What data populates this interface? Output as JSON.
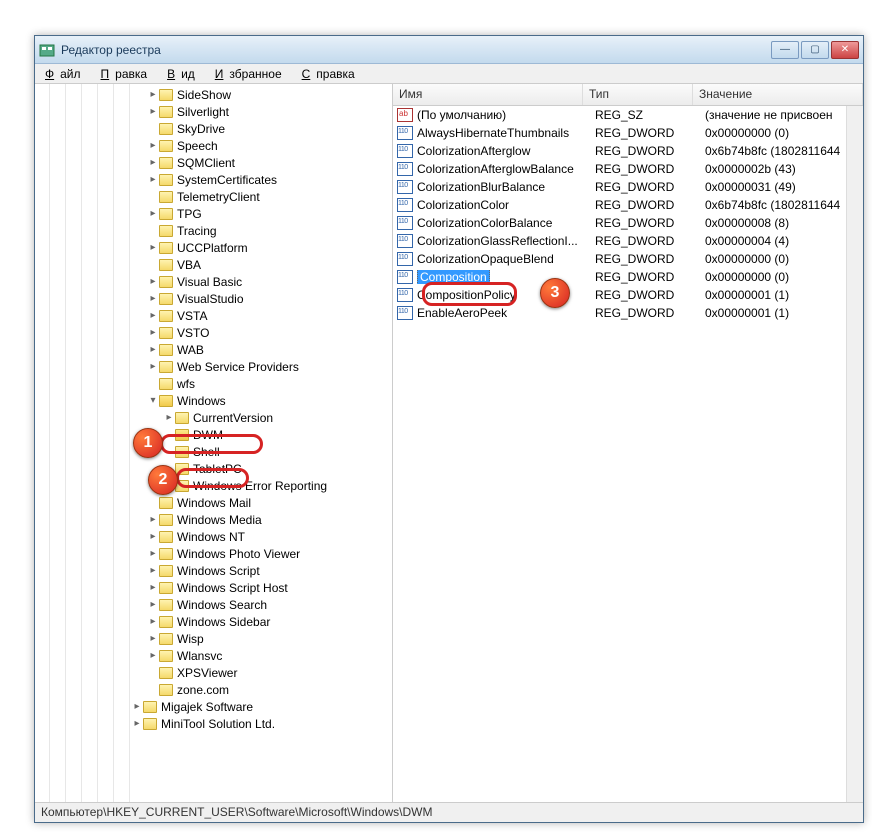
{
  "window": {
    "title": "Редактор реестра",
    "buttons": {
      "min": "—",
      "max": "▢",
      "close": "✕"
    }
  },
  "menu": {
    "file": "Файл",
    "edit": "Правка",
    "view": "Вид",
    "favorites": "Избранное",
    "help": "Справка"
  },
  "statusbar": "Компьютер\\HKEY_CURRENT_USER\\Software\\Microsoft\\Windows\\DWM",
  "columns": {
    "name": "Имя",
    "type": "Тип",
    "value": "Значение"
  },
  "tree": [
    {
      "indent": 7,
      "exp": "closed",
      "label": "SideShow"
    },
    {
      "indent": 7,
      "exp": "closed",
      "label": "Silverlight"
    },
    {
      "indent": 7,
      "exp": "none",
      "label": "SkyDrive"
    },
    {
      "indent": 7,
      "exp": "closed",
      "label": "Speech"
    },
    {
      "indent": 7,
      "exp": "closed",
      "label": "SQMClient"
    },
    {
      "indent": 7,
      "exp": "closed",
      "label": "SystemCertificates"
    },
    {
      "indent": 7,
      "exp": "none",
      "label": "TelemetryClient"
    },
    {
      "indent": 7,
      "exp": "closed",
      "label": "TPG"
    },
    {
      "indent": 7,
      "exp": "none",
      "label": "Tracing"
    },
    {
      "indent": 7,
      "exp": "closed",
      "label": "UCCPlatform"
    },
    {
      "indent": 7,
      "exp": "none",
      "label": "VBA"
    },
    {
      "indent": 7,
      "exp": "closed",
      "label": "Visual Basic"
    },
    {
      "indent": 7,
      "exp": "closed",
      "label": "VisualStudio"
    },
    {
      "indent": 7,
      "exp": "closed",
      "label": "VSTA"
    },
    {
      "indent": 7,
      "exp": "closed",
      "label": "VSTO"
    },
    {
      "indent": 7,
      "exp": "closed",
      "label": "WAB"
    },
    {
      "indent": 7,
      "exp": "closed",
      "label": "Web Service Providers"
    },
    {
      "indent": 7,
      "exp": "none",
      "label": "wfs"
    },
    {
      "indent": 7,
      "exp": "open",
      "label": "Windows",
      "open": true,
      "annot": 1
    },
    {
      "indent": 8,
      "exp": "closed",
      "label": "CurrentVersion"
    },
    {
      "indent": 8,
      "exp": "none",
      "label": "DWM",
      "open": true,
      "annot": 2
    },
    {
      "indent": 8,
      "exp": "none",
      "label": "Shell"
    },
    {
      "indent": 8,
      "exp": "none",
      "label": "TabletPC"
    },
    {
      "indent": 8,
      "exp": "closed",
      "label": "Windows Error Reporting"
    },
    {
      "indent": 7,
      "exp": "none",
      "label": "Windows Mail"
    },
    {
      "indent": 7,
      "exp": "closed",
      "label": "Windows Media"
    },
    {
      "indent": 7,
      "exp": "closed",
      "label": "Windows NT"
    },
    {
      "indent": 7,
      "exp": "closed",
      "label": "Windows Photo Viewer"
    },
    {
      "indent": 7,
      "exp": "closed",
      "label": "Windows Script"
    },
    {
      "indent": 7,
      "exp": "closed",
      "label": "Windows Script Host"
    },
    {
      "indent": 7,
      "exp": "closed",
      "label": "Windows Search"
    },
    {
      "indent": 7,
      "exp": "closed",
      "label": "Windows Sidebar"
    },
    {
      "indent": 7,
      "exp": "closed",
      "label": "Wisp"
    },
    {
      "indent": 7,
      "exp": "closed",
      "label": "Wlansvc"
    },
    {
      "indent": 7,
      "exp": "none",
      "label": "XPSViewer"
    },
    {
      "indent": 7,
      "exp": "none",
      "label": "zone.com"
    },
    {
      "indent": 6,
      "exp": "closed",
      "label": "Migajek Software"
    },
    {
      "indent": 6,
      "exp": "closed",
      "label": "MiniTool Solution Ltd."
    }
  ],
  "values": [
    {
      "icon": "str",
      "name": "(По умолчанию)",
      "type": "REG_SZ",
      "value": "(значение не присвоен"
    },
    {
      "icon": "bin",
      "name": "AlwaysHibernateThumbnails",
      "type": "REG_DWORD",
      "value": "0x00000000 (0)"
    },
    {
      "icon": "bin",
      "name": "ColorizationAfterglow",
      "type": "REG_DWORD",
      "value": "0x6b74b8fc (1802811644"
    },
    {
      "icon": "bin",
      "name": "ColorizationAfterglowBalance",
      "type": "REG_DWORD",
      "value": "0x0000002b (43)"
    },
    {
      "icon": "bin",
      "name": "ColorizationBlurBalance",
      "type": "REG_DWORD",
      "value": "0x00000031 (49)"
    },
    {
      "icon": "bin",
      "name": "ColorizationColor",
      "type": "REG_DWORD",
      "value": "0x6b74b8fc (1802811644"
    },
    {
      "icon": "bin",
      "name": "ColorizationColorBalance",
      "type": "REG_DWORD",
      "value": "0x00000008 (8)"
    },
    {
      "icon": "bin",
      "name": "ColorizationGlassReflectionI...",
      "type": "REG_DWORD",
      "value": "0x00000004 (4)"
    },
    {
      "icon": "bin",
      "name": "ColorizationOpaqueBlend",
      "type": "REG_DWORD",
      "value": "0x00000000 (0)"
    },
    {
      "icon": "bin",
      "name": "Composition",
      "type": "REG_DWORD",
      "value": "0x00000000 (0)",
      "selected": true,
      "annot": 3
    },
    {
      "icon": "bin",
      "name": "CompositionPolicy",
      "type": "REG_DWORD",
      "value": "0x00000001 (1)"
    },
    {
      "icon": "bin",
      "name": "EnableAeroPeek",
      "type": "REG_DWORD",
      "value": "0x00000001 (1)"
    }
  ],
  "annotations": {
    "1": "1",
    "2": "2",
    "3": "3"
  }
}
